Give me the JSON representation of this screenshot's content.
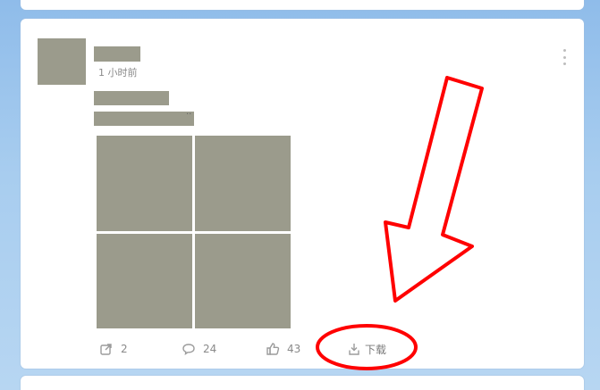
{
  "post": {
    "timestamp": "1 小时前",
    "line2_dots": "..",
    "actions": {
      "share_count": "2",
      "comment_count": "24",
      "like_count": "43",
      "download_label": "下载"
    }
  },
  "icons": {
    "share": "share-icon",
    "comment": "comment-icon",
    "like": "thumbs-up-icon",
    "download": "download-icon",
    "menu": "more-vertical-icon"
  },
  "colors": {
    "background": "#a8cdef",
    "card": "#ffffff",
    "placeholder": "#9b9b8c",
    "annotation": "#ff0000"
  }
}
